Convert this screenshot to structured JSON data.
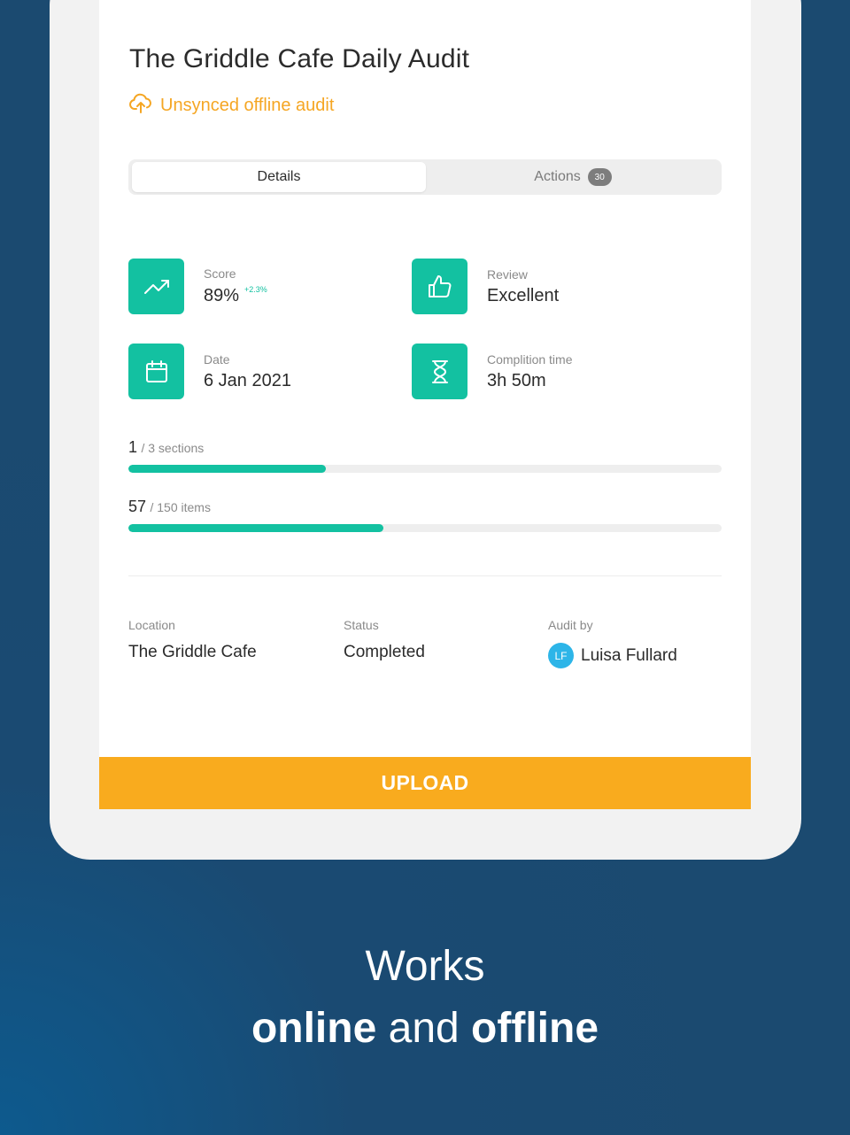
{
  "audit": {
    "title": "The Griddle Cafe Daily Audit",
    "sync_status": "Unsynced offline audit"
  },
  "tabs": {
    "details": "Details",
    "actions": "Actions",
    "actions_count": "30"
  },
  "stats": {
    "score": {
      "label": "Score",
      "value": "89%",
      "delta": "+2.3%"
    },
    "review": {
      "label": "Review",
      "value": "Excellent"
    },
    "date": {
      "label": "Date",
      "value": "6 Jan 2021"
    },
    "time": {
      "label": "Complition time",
      "value": "3h 50m"
    }
  },
  "progress": {
    "sections": {
      "done": "1",
      "suffix": "/ 3 sections",
      "fraction": 0.333
    },
    "items": {
      "done": "57",
      "suffix": "/ 150 items",
      "fraction": 0.43
    }
  },
  "meta": {
    "location_label": "Location",
    "location_value": "The Griddle Cafe",
    "status_label": "Status",
    "status_value": "Completed",
    "auditor_label": "Audit by",
    "auditor_initials": "LF",
    "auditor_name": "Luisa Fullard"
  },
  "upload_label": "UPLOAD",
  "tagline": {
    "line1": "Works",
    "bold1": "online",
    "middle": " and ",
    "bold2": "offline"
  },
  "colors": {
    "accent": "#13c1a1",
    "warning": "#f5a623",
    "upload": "#f9ab1e",
    "background": "#1b4a70",
    "avatar": "#2db5e8"
  }
}
